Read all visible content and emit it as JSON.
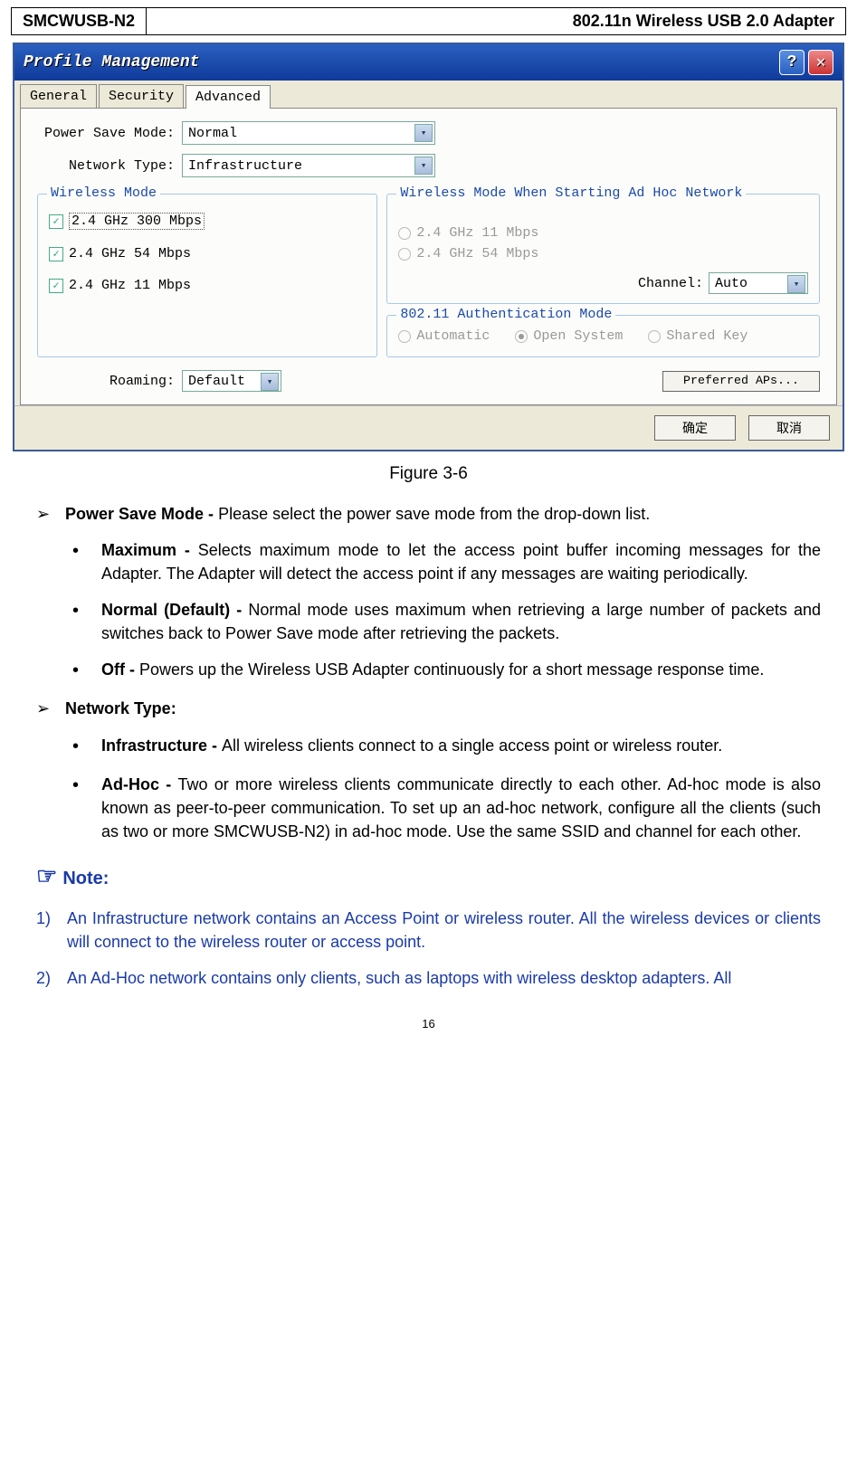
{
  "header": {
    "left": "SMCWUSB-N2",
    "right": "802.11n Wireless USB 2.0 Adapter"
  },
  "dialog": {
    "title": "Profile Management",
    "tabs": {
      "general": "General",
      "security": "Security",
      "advanced": "Advanced"
    },
    "psm_label": "Power Save Mode:",
    "psm_value": "Normal",
    "nt_label": "Network Type:",
    "nt_value": "Infrastructure",
    "wm_legend": "Wireless Mode",
    "wm_opt1": "2.4 GHz 300 Mbps",
    "wm_opt2": "2.4 GHz 54 Mbps",
    "wm_opt3": "2.4 GHz 11 Mbps",
    "wmah_legend": "Wireless Mode When Starting Ad Hoc Network",
    "wmah_opt1": "2.4 GHz 11 Mbps",
    "wmah_opt2": "2.4 GHz 54 Mbps",
    "channel_label": "Channel:",
    "channel_value": "Auto",
    "auth_legend": "802.11 Authentication Mode",
    "auth_auto": "Automatic",
    "auth_open": "Open System",
    "auth_shared": "Shared Key",
    "roaming_label": "Roaming:",
    "roaming_value": "Default",
    "pref_btn": "Preferred APs...",
    "ok_btn": "确定",
    "cancel_btn": "取消"
  },
  "caption": "Figure 3-6",
  "content": {
    "psm_head": "Power Save Mode - ",
    "psm_text": "Please select the power save mode from the drop-down list.",
    "max_head": "Maximum - ",
    "max_text": "Selects maximum mode to let the access point buffer incoming messages for the Adapter. The Adapter will detect the access point if any messages are waiting periodically.",
    "norm_head": "Normal (Default) - ",
    "norm_text": "Normal mode uses maximum when retrieving a large number of packets and switches back to Power Save mode after retrieving the packets.",
    "off_head": "Off - ",
    "off_text": "Powers up the Wireless USB Adapter continuously for a short message response time.",
    "nt_head": "Network Type:",
    "infra_head": "Infrastructure - ",
    "infra_text": "All wireless clients connect to a single access point or wireless router.",
    "adhoc_head": "Ad-Hoc - ",
    "adhoc_text": "Two or more wireless clients communicate directly to each other. Ad-hoc mode is also known as peer-to-peer communication. To set up an ad-hoc network, configure all the clients (such as two or more SMCWUSB-N2) in ad-hoc mode. Use the same SSID and channel for each other.",
    "note_label": "Note:",
    "note1_num": "1)",
    "note1_text": "An Infrastructure network contains an Access Point or wireless router. All the wireless devices or clients will connect to the wireless router or access point.",
    "note2_num": "2)",
    "note2_text": "An Ad-Hoc network contains only clients, such as laptops with wireless desktop adapters. All"
  },
  "page_number": "16"
}
